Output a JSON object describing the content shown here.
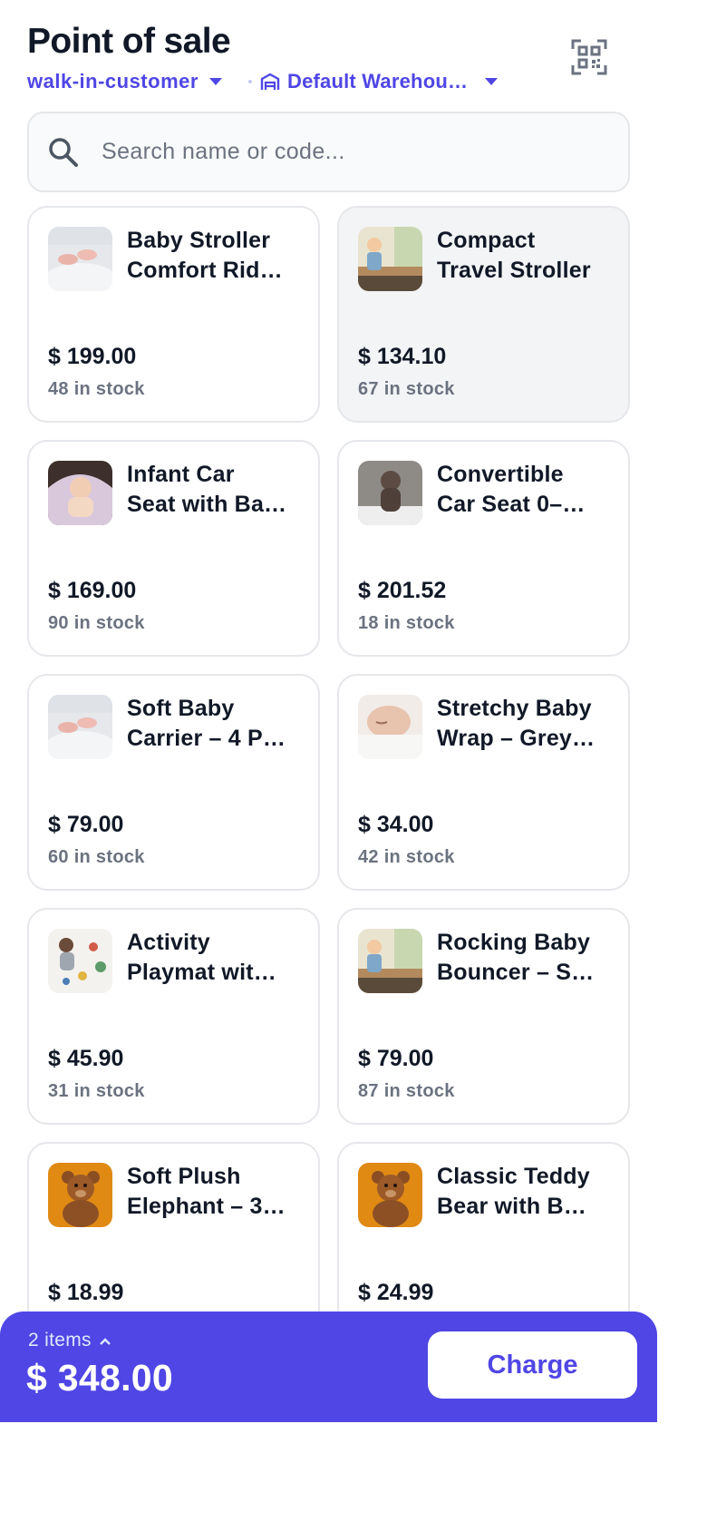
{
  "header": {
    "title": "Point of sale",
    "customer": "walk-in-customer",
    "warehouse": "Default Warehouse",
    "qr_icon": "qr-code-icon"
  },
  "search": {
    "placeholder": "Search name or code...",
    "value": "",
    "icon": "search-icon"
  },
  "products": [
    {
      "line1": "Baby Stroller",
      "line2": "Comfort Rid…",
      "price": "$ 199.00",
      "stock": "48 in stock",
      "image": "baby-feet-photo"
    },
    {
      "line1": "Compact",
      "line2": "Travel Stroller",
      "price": "$ 134.10",
      "stock": "67 in stock",
      "image": "toddler-on-bench-photo"
    },
    {
      "line1": "Infant Car",
      "line2": "Seat with Ba…",
      "price": "$ 169.00",
      "stock": "90 in stock",
      "image": "baby-in-blanket-photo"
    },
    {
      "line1": "Convertible",
      "line2": "Car Seat 0–…",
      "price": "$ 201.52",
      "stock": "18 in stock",
      "image": "baby-bear-suit-photo"
    },
    {
      "line1": "Soft Baby",
      "line2": "Carrier – 4 P…",
      "price": "$ 79.00",
      "stock": "60 in stock",
      "image": "baby-feet-photo"
    },
    {
      "line1": "Stretchy Baby",
      "line2": "Wrap – Grey…",
      "price": "$ 34.00",
      "stock": "42 in stock",
      "image": "sleeping-baby-photo"
    },
    {
      "line1": "Activity",
      "line2": "Playmat wit…",
      "price": "$ 45.90",
      "stock": "31 in stock",
      "image": "baby-with-toys-photo"
    },
    {
      "line1": "Rocking Baby",
      "line2": "Bouncer – S…",
      "price": "$ 79.00",
      "stock": "87 in stock",
      "image": "toddler-on-bench-photo"
    },
    {
      "line1": "Soft Plush",
      "line2": "Elephant – 3…",
      "price": "$ 18.99",
      "stock": "",
      "image": "teddy-bear-photo"
    },
    {
      "line1": "Classic Teddy",
      "line2": "Bear with B…",
      "price": "$ 24.99",
      "stock": "",
      "image": "teddy-bear-photo"
    }
  ],
  "cart": {
    "items_label": "2 items",
    "total": "$ 348.00",
    "charge_label": "Charge"
  },
  "colors": {
    "accent": "#4f46e5",
    "selected_card": "#f3f4f6"
  }
}
